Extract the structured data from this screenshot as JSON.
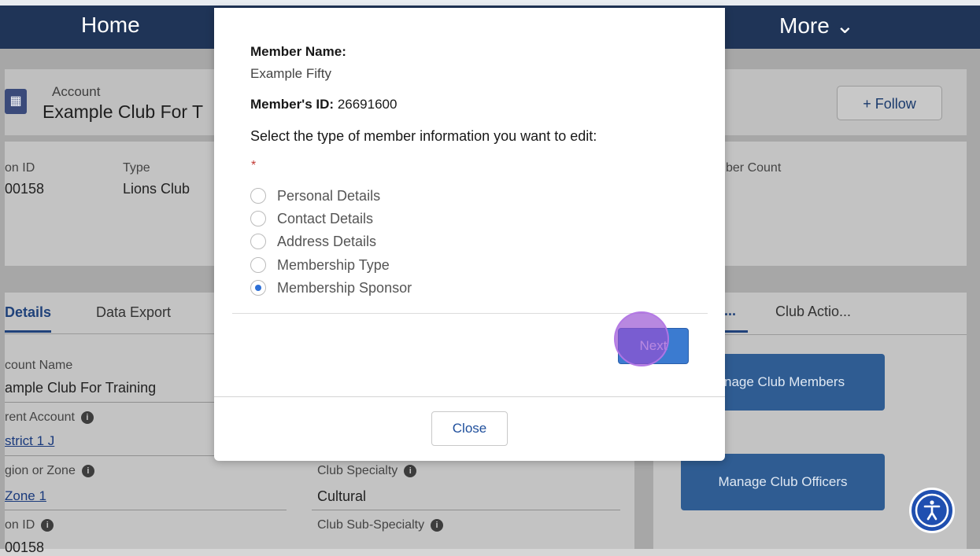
{
  "nav": {
    "home": "Home",
    "more": "More ⌄"
  },
  "account": {
    "icon": "building-icon",
    "type_label": "Account",
    "name": "Example Club For T",
    "follow_label": "+ Follow"
  },
  "highlights": {
    "id_label": "on ID",
    "id_value": "00158",
    "type_label": "Type",
    "type_value": "Lions Club",
    "member_count_label": "ber Count"
  },
  "tabs": {
    "details": "Details",
    "data_export": "Data Export"
  },
  "fields": {
    "account_name_label": "count Name",
    "account_name_value": "ample Club For Training",
    "parent_label": "rent Account",
    "parent_value": "strict 1 J",
    "region_label": "gion or Zone",
    "region_value": "Zone 1",
    "club_id_label": "on ID",
    "club_id_value": "00158",
    "specialty_label": "Club Specialty",
    "specialty_value": "Cultural",
    "subspecialty_label": "Club Sub-Specialty"
  },
  "right_panel": {
    "tab1": "...",
    "tab2": "Club Actio...",
    "manage_members": "nage Club Members",
    "manage_officers": "Manage Club Officers"
  },
  "modal": {
    "member_name_label": "Member Name:",
    "member_name_value": "Example Fifty",
    "member_id_label": "Member's ID:",
    "member_id_value": "26691600",
    "prompt": "Select the type of member information you want to edit:",
    "required_mark": "*",
    "options": [
      {
        "label": "Personal Details",
        "selected": false
      },
      {
        "label": "Contact Details",
        "selected": false
      },
      {
        "label": "Address Details",
        "selected": false
      },
      {
        "label": "Membership Type",
        "selected": false
      },
      {
        "label": "Membership Sponsor",
        "selected": true
      }
    ],
    "next_label": "Next",
    "close_label": "Close"
  },
  "colors": {
    "nav": "#1f3457",
    "primary": "#3b7bd0",
    "click_marker": "#9650d2"
  }
}
